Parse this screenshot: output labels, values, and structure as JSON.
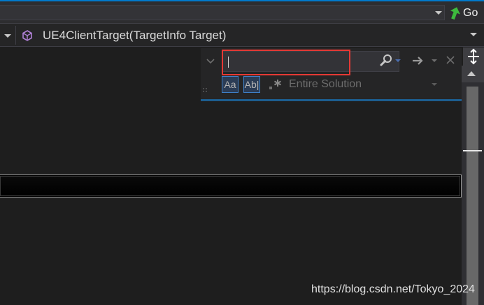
{
  "toolbar": {
    "go_label": "Go"
  },
  "navigation_bar": {
    "member_selector": "UE4ClientTarget(TargetInfo Target)"
  },
  "find_panel": {
    "search_value": "",
    "match_case_label": "Aa",
    "match_whole_word_label": "Ab|",
    "scope": "Entire Solution"
  },
  "watermark": {
    "text": "https://blog.csdn.net/Tokyo_2024"
  },
  "colors": {
    "accent": "#007acc",
    "highlight_box": "#e53935",
    "background": "#1e1e1e"
  },
  "icons": {
    "go_icon": "green-arrow-icon",
    "member_icon": "purple-cube-icon",
    "search_icon": "magnifier-icon",
    "next_icon": "arrow-right-icon",
    "close_icon": "close-icon",
    "regex_icon": "regex-star-icon",
    "splitter_icon": "split-vertical-icon"
  }
}
